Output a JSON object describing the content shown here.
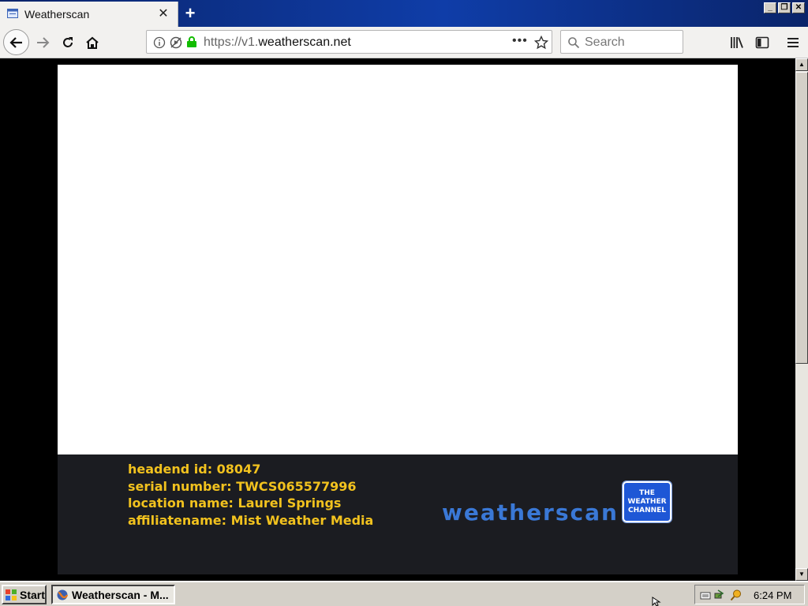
{
  "browser": {
    "tab": {
      "title": "Weatherscan",
      "favicon": "page-icon"
    },
    "url": {
      "scheme": "https://v1.",
      "host": "weatherscan.net"
    },
    "search": {
      "placeholder": "Search"
    }
  },
  "page": {
    "info_lines": [
      "headend id: 08047",
      "serial number: TWCS065577996",
      "location name: Laurel Springs",
      "affiliatename: Mist Weather Media"
    ],
    "brand": "weatherscan",
    "logo_lines": [
      "THE",
      "WEATHER",
      "CHANNEL"
    ]
  },
  "taskbar": {
    "start_label": "Start",
    "task_label": "Weatherscan - M...",
    "time": "6:24 PM"
  },
  "colors": {
    "info_text": "#f2c21e",
    "brand_blue": "#3a78d6",
    "logo_blue": "#1e57d6",
    "titlebar": "#0a246a"
  }
}
